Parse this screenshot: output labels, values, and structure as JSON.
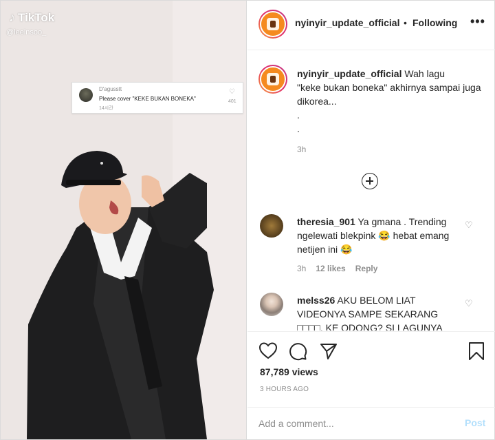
{
  "media": {
    "tiktok_logo": "TikTok",
    "tiktok_handle": "@leeinsoo_",
    "reply_card": {
      "user": "D'agusstt",
      "text": "Please cover \"KEKE BUKAN BONEKA\"",
      "time": "14시간",
      "likes": "401"
    }
  },
  "header": {
    "username": "nyinyir_update_official",
    "separator": "•",
    "follow_status": "Following",
    "more": "•••"
  },
  "caption": {
    "username": "nyinyir_update_official",
    "text_line1": "Wah lagu",
    "text_rest": "\"keke bukan boneka\" akhirnya sampai juga dikorea...",
    "dots": ".",
    "time": "3h"
  },
  "comments": [
    {
      "username": "theresia_901",
      "text": "Ya gmana . Trending ngelewati blekpink 😂 hebat emang netijen ini 😂",
      "time": "3h",
      "likes": "12 likes",
      "reply": "Reply"
    },
    {
      "username": "melss26",
      "text": "AKU BELOM LIAT VIDEONYA SAMPE SEKARANG □□□□, KE ODONG? SI LAGUNYA"
    }
  ],
  "stats": {
    "views": "87,789 views",
    "post_time": "3 HOURS AGO"
  },
  "compose": {
    "placeholder": "Add a comment...",
    "post_label": "Post"
  },
  "colors": {
    "post_disabled": "#b2dffc",
    "muted": "#8e8e8e",
    "text": "#262626",
    "story_ring": "#e1306c"
  },
  "icons": [
    "heart-icon",
    "comment-icon",
    "share-icon",
    "bookmark-icon",
    "load-more-icon",
    "more-icon"
  ]
}
